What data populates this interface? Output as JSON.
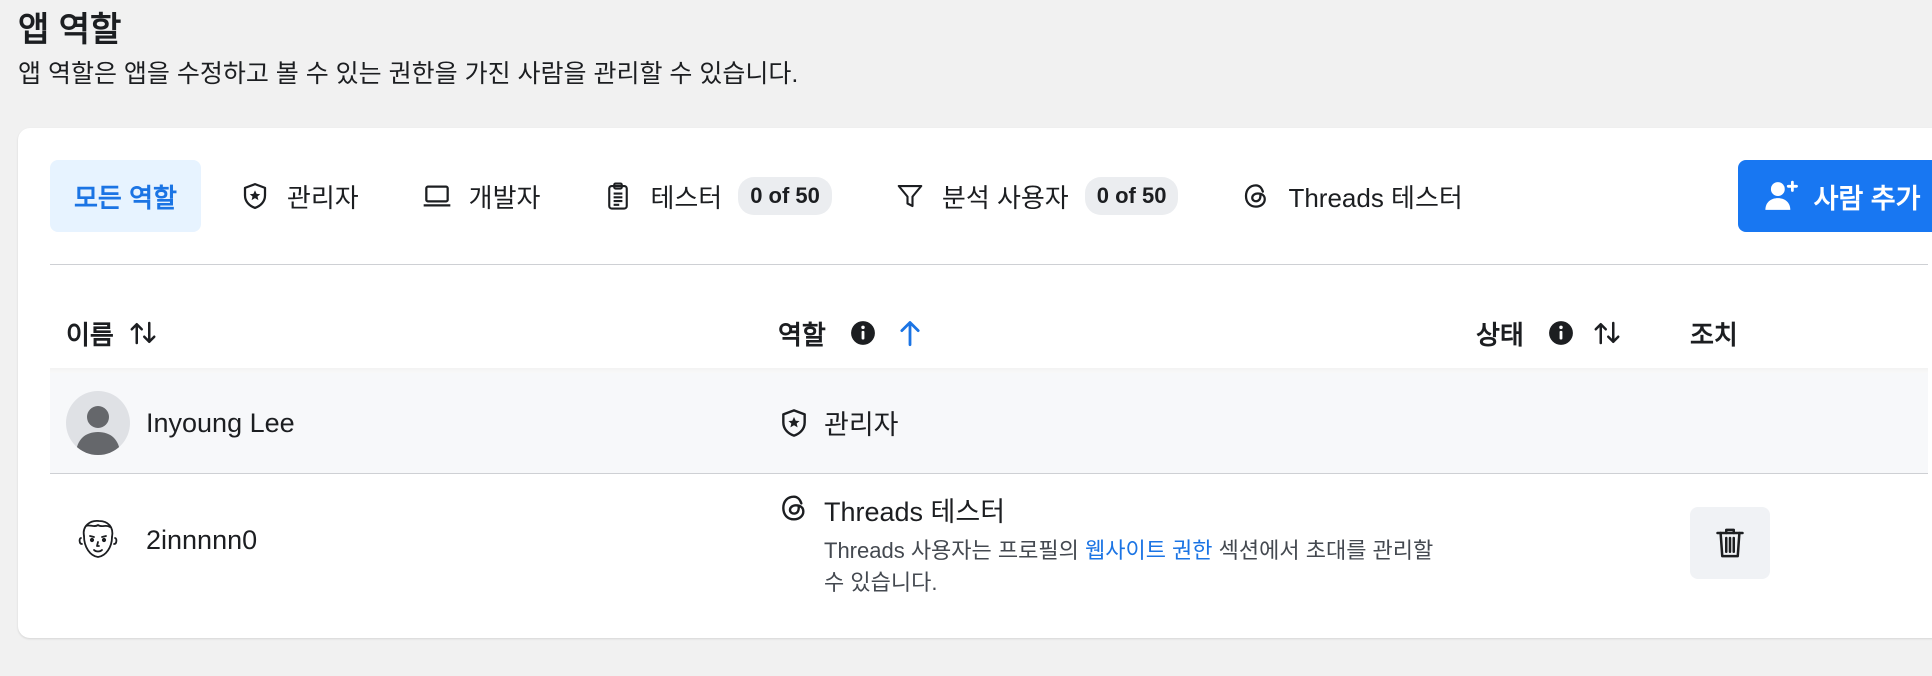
{
  "header": {
    "title": "앱 역할",
    "description": "앱 역할은 앱을 수정하고 볼 수 있는 권한을 가진 사람을 관리할 수 있습니다."
  },
  "tabs": [
    {
      "label": "모든 역할",
      "icon": null,
      "active": true
    },
    {
      "label": "관리자",
      "icon": "shield-star-icon"
    },
    {
      "label": "개발자",
      "icon": "laptop-icon"
    },
    {
      "label": "테스터",
      "icon": "clipboard-icon",
      "badge": "0 of 50"
    },
    {
      "label": "분석 사용자",
      "icon": "filter-icon",
      "badge": "0 of 50"
    },
    {
      "label": "Threads 테스터",
      "icon": "threads-icon"
    }
  ],
  "add_button": {
    "label": "사람 추가",
    "icon": "add-person-icon"
  },
  "table": {
    "columns": {
      "name": "이름",
      "role": "역할",
      "status": "상태",
      "actions": "조치"
    },
    "rows": [
      {
        "name": "Inyoung Lee",
        "avatar": "default-avatar",
        "role": "관리자",
        "role_icon": "shield-star-icon"
      },
      {
        "name": "2innnnn0",
        "avatar": "cartoon-avatar",
        "role": "Threads 테스터",
        "role_icon": "threads-icon",
        "note_before": "Threads 사용자는 프로필의 ",
        "note_link": "웹사이트 권한",
        "note_after": " 섹션에서 초대를 관리할 수 있습니다."
      }
    ]
  },
  "colors": {
    "accent": "#1877f2",
    "link": "#1b74e4",
    "active_tab_bg": "#e7f3ff",
    "background": "#f1f1f1"
  }
}
